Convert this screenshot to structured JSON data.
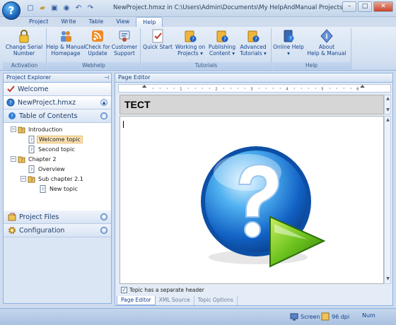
{
  "window": {
    "title": "NewProject.hmxz in C:\\Users\\Admin\\Documents\\My HelpAndManual Projects - Help & Manual",
    "app_button_glyph": "?"
  },
  "quick_access": [
    "new-icon",
    "open-icon",
    "save-icon",
    "globe-icon",
    "undo-icon",
    "redo-icon"
  ],
  "tabs": [
    "Project",
    "Write",
    "Table",
    "View",
    "Help"
  ],
  "active_tab": "Help",
  "ribbon": {
    "groups": [
      {
        "name": "Activation",
        "buttons": [
          {
            "label": "Change Serial\nNumber",
            "icon": "lock-icon"
          }
        ]
      },
      {
        "name": "Webhelp",
        "buttons": [
          {
            "label": "Help & Manual\nHomepage",
            "icon": "people-icon"
          },
          {
            "label": "Check for\nUpdate",
            "icon": "rss-icon"
          },
          {
            "label": "Customer\nSupport",
            "icon": "support-icon"
          }
        ]
      },
      {
        "name": "Tutorials",
        "buttons": [
          {
            "label": "Quick Start",
            "icon": "checklist-icon"
          },
          {
            "label": "Working on\nProjects ▾",
            "icon": "folder-help-icon"
          },
          {
            "label": "Publishing\nContent ▾",
            "icon": "folder-help-icon"
          },
          {
            "label": "Advanced\nTutorials ▾",
            "icon": "folder-help-icon"
          }
        ]
      },
      {
        "name": "Help",
        "buttons": [
          {
            "label": "Online Help\n▾",
            "icon": "book-help-icon"
          },
          {
            "label": "About\nHelp & Manual",
            "icon": "info-icon"
          }
        ]
      }
    ]
  },
  "project_explorer": {
    "title": "Project Explorer",
    "welcome": "Welcome",
    "project_name": "NewProject.hmxz",
    "toc_label": "Table of Contents",
    "tree": [
      {
        "label": "Introduction",
        "level": 1,
        "type": "chapter",
        "expand": "−"
      },
      {
        "label": "Welcome topic",
        "level": 2,
        "type": "topic",
        "selected": true
      },
      {
        "label": "Second topic",
        "level": 2,
        "type": "topic"
      },
      {
        "label": "Chapter 2",
        "level": 1,
        "type": "chapter",
        "expand": "−"
      },
      {
        "label": "Overview",
        "level": 2,
        "type": "topic"
      },
      {
        "label": "Sub chapter 2.1",
        "level": 2,
        "type": "chapter",
        "expand": "−"
      },
      {
        "label": "New topic",
        "level": 3,
        "type": "topic"
      }
    ],
    "project_files": "Project Files",
    "configuration": "Configuration"
  },
  "editor": {
    "title": "Page Editor",
    "topic_header": "TECT",
    "separate_header_label": "Topic has a separate header",
    "separate_header_checked": true,
    "ruler_numbers": [
      "1",
      "2",
      "3",
      "4",
      "5",
      "6"
    ],
    "bottom_tabs": [
      "Page Editor",
      "XML Source",
      "Topic Options"
    ],
    "active_bottom_tab": "Page Editor"
  },
  "status": {
    "screen": "Screen",
    "dpi": "96 dpi",
    "num": "Num"
  },
  "colors": {
    "accent": "#15428b",
    "ribbon_bg": "#d5e2f2",
    "selection": "#fbe4b6"
  }
}
